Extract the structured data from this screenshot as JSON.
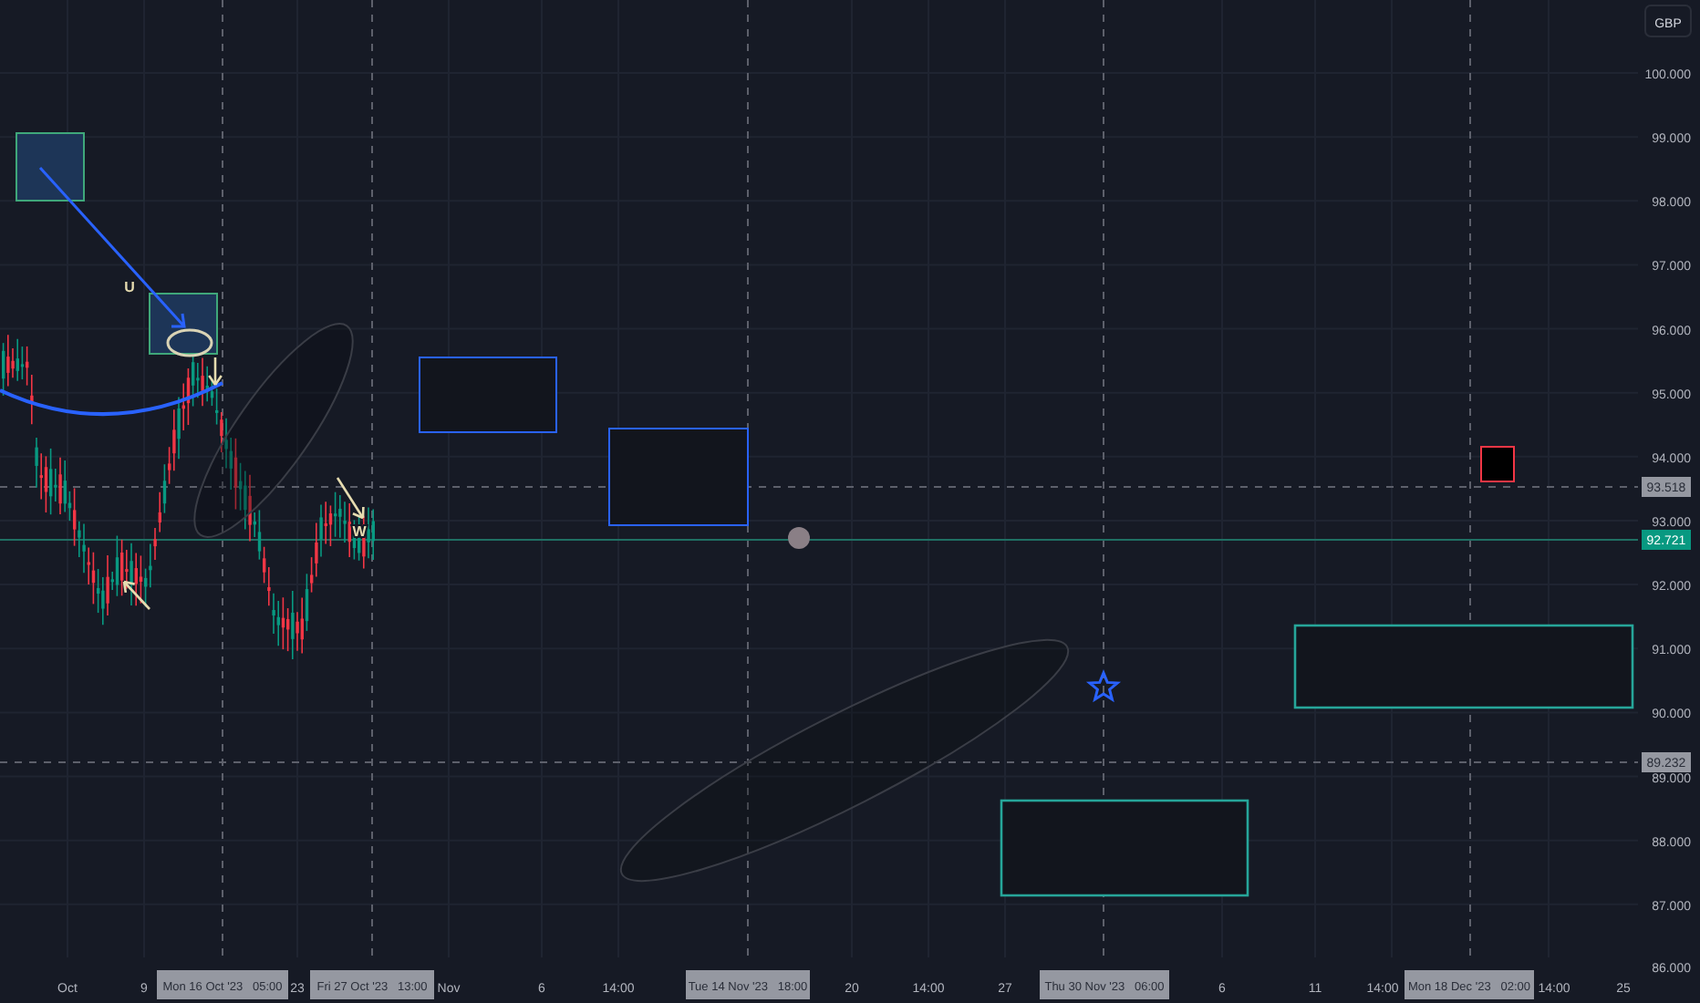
{
  "price_axis": {
    "currency": "GBP",
    "labels": [
      "100.000",
      "99.000",
      "98.000",
      "97.000",
      "96.000",
      "95.000",
      "94.000",
      "93.000",
      "92.000",
      "91.000",
      "90.000",
      "89.000",
      "88.000",
      "87.000",
      "86.000"
    ]
  },
  "price_markers": [
    {
      "text": "93.518",
      "kind": "level"
    },
    {
      "text": "92.721",
      "kind": "last"
    },
    {
      "text": "89.232",
      "kind": "level"
    }
  ],
  "time_axis": {
    "labels": [
      "Oct",
      "9",
      "23",
      "Nov",
      "6",
      "14:00",
      "20",
      "14:00",
      "27",
      "6",
      "11",
      "14:00",
      "14:00",
      "25"
    ],
    "crosshair_labels": [
      "Mon 16 Oct '23   05:00",
      "Fri 27 Oct '23   13:00",
      "Tue 14 Nov '23   18:00",
      "Thu 30 Nov '23   06:00",
      "Mon 18 Dec '23   02:00"
    ]
  },
  "annotations": [
    {
      "text": "U"
    },
    {
      "text": "W"
    }
  ]
}
